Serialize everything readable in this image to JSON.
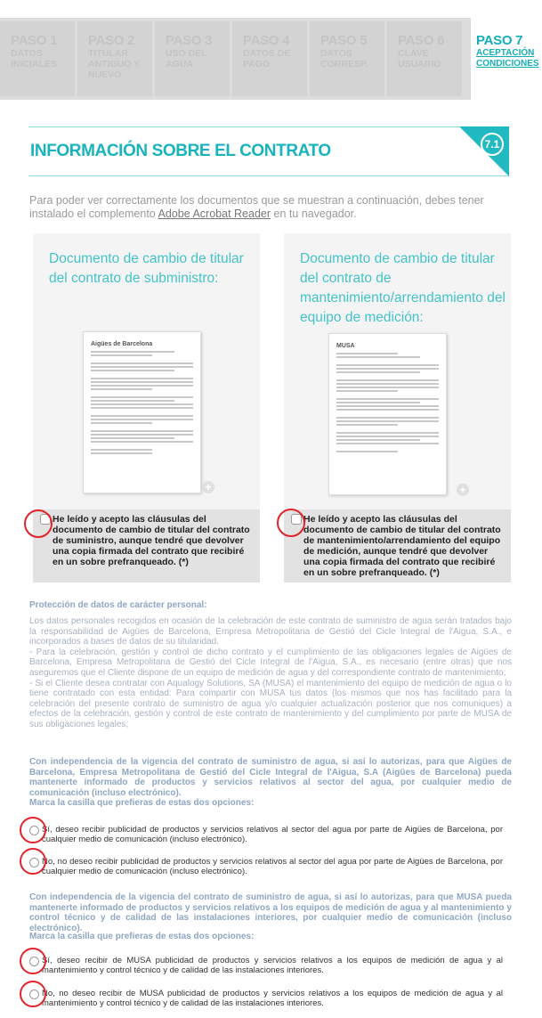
{
  "steps": [
    {
      "num": "PASO 1",
      "label": "DATOS INICIALES"
    },
    {
      "num": "PASO 2",
      "label": "TITULAR ANTIGUO Y NUEVO"
    },
    {
      "num": "PASO 3",
      "label": "USO DEL AGUA"
    },
    {
      "num": "PASO 4",
      "label": "DATOS DE PAGO"
    },
    {
      "num": "PASO 5",
      "label": "DATOS CORRESP."
    },
    {
      "num": "PASO 6",
      "label": "CLAVE USUARIO"
    },
    {
      "num": "PASO 7",
      "label": "ACEPTACIÓN CONDICIONES"
    }
  ],
  "section": {
    "title": "INFORMACIÓN SOBRE EL CONTRATO",
    "number": "7.1"
  },
  "intro": {
    "before": "Para poder ver correctamente los documentos que se muestran a continuación, debes tener instalado el complemento ",
    "link": "Adobe Acrobat Reader",
    "after": " en tu navegador."
  },
  "documents": [
    {
      "title": "Documento de cambio de titular del contrato de subministro:",
      "logo": "Aigües de Barcelona",
      "accept": "He leído y acepto las cláusulas del documento de cambio de titular del contrato de suministro, aunque tendré que devolver una copia firmada del contrato que recibiré en un sobre prefranqueado. (*)"
    },
    {
      "title": "Documento de cambio de titular del contrato de mantenimiento/arrendamiento del equipo de medición:",
      "logo": "MUSA",
      "accept": "He leído y acepto las cláusulas del documento de cambio de titular del contrato de mantenimiento/arrendamiento del equipo de medición, aunque tendré que devolver una copia firmada del contrato que recibiré en un sobre prefranqueado. (*)"
    }
  ],
  "data_protection": {
    "title": "Protección de datos de carácter personal:",
    "text": "Los datos personales recogidos en ocasión de la celebración de este contrato de suministro de agua serán tratados bajo la responsabilidad de Aigües de Barcelona, Empresa Metropolitana de Gestió del Cicle Integral de l'Aigua, S.A., e incorporados a bases de datos de su titularidad.\n- Para la celebración, gestión y control de dicho contrato y el cumplimiento de las obligaciones legales de Aigües de Barcelona, Empresa Metropolitana de Gestió del Cicle Integral de l'Aigua, S.A., es necesario (entre otras) que nos aseguremos que el Cliente dispone de un equipo de medición de agua y del correspondiente contrato de mantenimiento;\n- Si el Cliente desea contratar con Aqualogy Solutions, SA (MUSA) el mantenimiento del equipo de medición de agua o lo tiene contratado con esta entidad: Para compartir con MUSA tus datos (los mismos que nos has facilitado para la celebración del presente contrato de suministro de agua y/o cualquier actualización posterior que nos comuniques) a efectos de la celebración, gestión y control de este contrato de mantenimiento y del cumplimiento por parte de MUSA de sus obligaciones legales;",
    "consent_aigues": "Con independencia de la vigencia del contrato de suministro de agua, si así lo autorizas, para que Aigües de Barcelona, Empresa Metropolitana de Gestió del Cicle Integral de l'Aigua, S.A (Aigües de Barcelona) pueda mantenerte informado de productos y servicios relativos al sector del agua, por cualquier medio de comunicación (incluso electrónico).",
    "choose_label_1": "Marca la casilla que prefieras de estas dos opciones:",
    "option_aigues_yes": "Sí, deseo recibir publicidad de productos y servicios relativos al sector del agua por parte de Aigües de Barcelona, por cualquier medio de comunicación (incluso electrónico).",
    "option_aigues_no": "No, no deseo recibir publicidad de productos y servicios relativos al sector del agua por parte de Aigües de Barcelona, por cualquier medio de comunicación (incluso electrónico).",
    "consent_musa": "Con independencia de la vigencia del contrato de suministro de agua, si así lo autorizas, para que MUSA pueda mantenerte informado de productos y servicios relativos a los equipos de medición de agua y al mantenimiento y control técnico y de calidad de las instalaciones interiores, por cualquier medio de comunicación (incluso electrónico).",
    "choose_label_2": "Marca la casilla que prefieras de estas dos opciones:",
    "option_musa_yes": "Sí, deseo recibir de MUSA publicidad de productos y servicios relativos a los equipos de medición de agua y al mantenimiento y control técnico y de calidad de las instalaciones interiores.",
    "option_musa_no": "No, no deseo recibir de MUSA publicidad de productos y servicios relativos a los equipos de medición de agua y al mantenimiento y control técnico y de calidad de las instalaciones interiores."
  },
  "colors": {
    "accent": "#19b3bd",
    "highlight_marker": "#e2232a",
    "muted_blue": "#8fa6c3"
  }
}
